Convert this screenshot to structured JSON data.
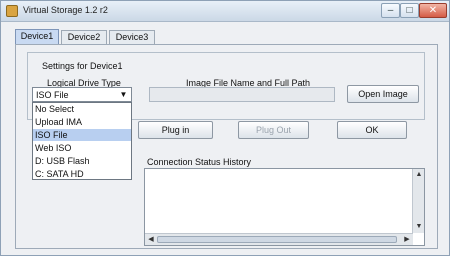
{
  "window": {
    "title": "Virtual Storage 1.2 r2",
    "controls": {
      "minimize": "–",
      "maximize": "□",
      "close": "✕"
    }
  },
  "tabs": [
    {
      "label": "Device1",
      "active": true
    },
    {
      "label": "Device2",
      "active": false
    },
    {
      "label": "Device3",
      "active": false
    }
  ],
  "settings": {
    "title": "Settings for Device1",
    "drive_type_label": "Logical Drive Type",
    "image_label": "Image File Name and Full Path",
    "drive_type_value": "ISO File",
    "image_path_value": "",
    "open_image": "Open Image"
  },
  "dropdown": {
    "options": [
      "No Select",
      "Upload IMA",
      "ISO File",
      "Web ISO",
      "D: USB Flash",
      "C: SATA HD"
    ],
    "selected": "ISO File"
  },
  "actions": {
    "plug_in": "Plug in",
    "plug_out": "Plug Out",
    "ok": "OK"
  },
  "history": {
    "label": "Connection Status History"
  },
  "colors": {
    "tab_active": "#c9daf2",
    "selected_option": "#b8cff0",
    "close_button": "#d45c46"
  }
}
